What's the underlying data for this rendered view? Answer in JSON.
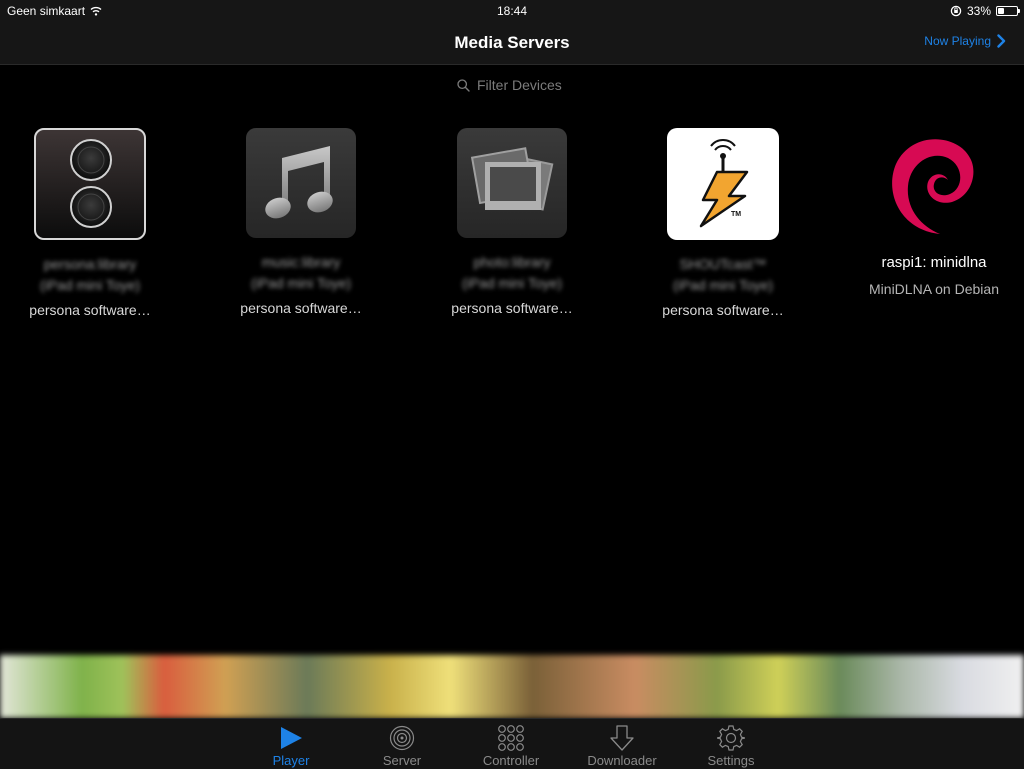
{
  "status_bar": {
    "carrier": "Geen simkaart",
    "time": "18:44",
    "battery_percent": "33%",
    "battery_level": 0.33
  },
  "nav": {
    "title": "Media Servers",
    "now_playing_label": "Now Playing"
  },
  "filter": {
    "placeholder": "Filter Devices",
    "value": ""
  },
  "devices": [
    {
      "icon": "speaker-icon",
      "name": "persona:library",
      "host": "(iPad mini Toye)",
      "vendor": "persona software…"
    },
    {
      "icon": "music-note-icon",
      "name": "music:library",
      "host": "(iPad mini Toye)",
      "vendor": "persona software…"
    },
    {
      "icon": "photo-stack-icon",
      "name": "photo:library",
      "host": "(iPad mini Toye)",
      "vendor": "persona software…"
    },
    {
      "icon": "shoutcast-icon",
      "name": "SHOUTcast™",
      "host": "(iPad mini Toye)",
      "vendor": "persona software…"
    },
    {
      "icon": "debian-swirl-icon",
      "name": "raspi1: minidlna",
      "description": "MiniDLNA on Debian"
    }
  ],
  "tabs": [
    {
      "label": "Player",
      "icon": "play-icon",
      "active": true
    },
    {
      "label": "Server",
      "icon": "server-icon",
      "active": false
    },
    {
      "label": "Controller",
      "icon": "grid-dots-icon",
      "active": false
    },
    {
      "label": "Downloader",
      "icon": "download-arrow-icon",
      "active": false
    },
    {
      "label": "Settings",
      "icon": "gear-icon",
      "active": false
    }
  ],
  "colors": {
    "accent": "#1e82e6",
    "debian": "#d70a53",
    "shoutcast": "#f2a530"
  }
}
